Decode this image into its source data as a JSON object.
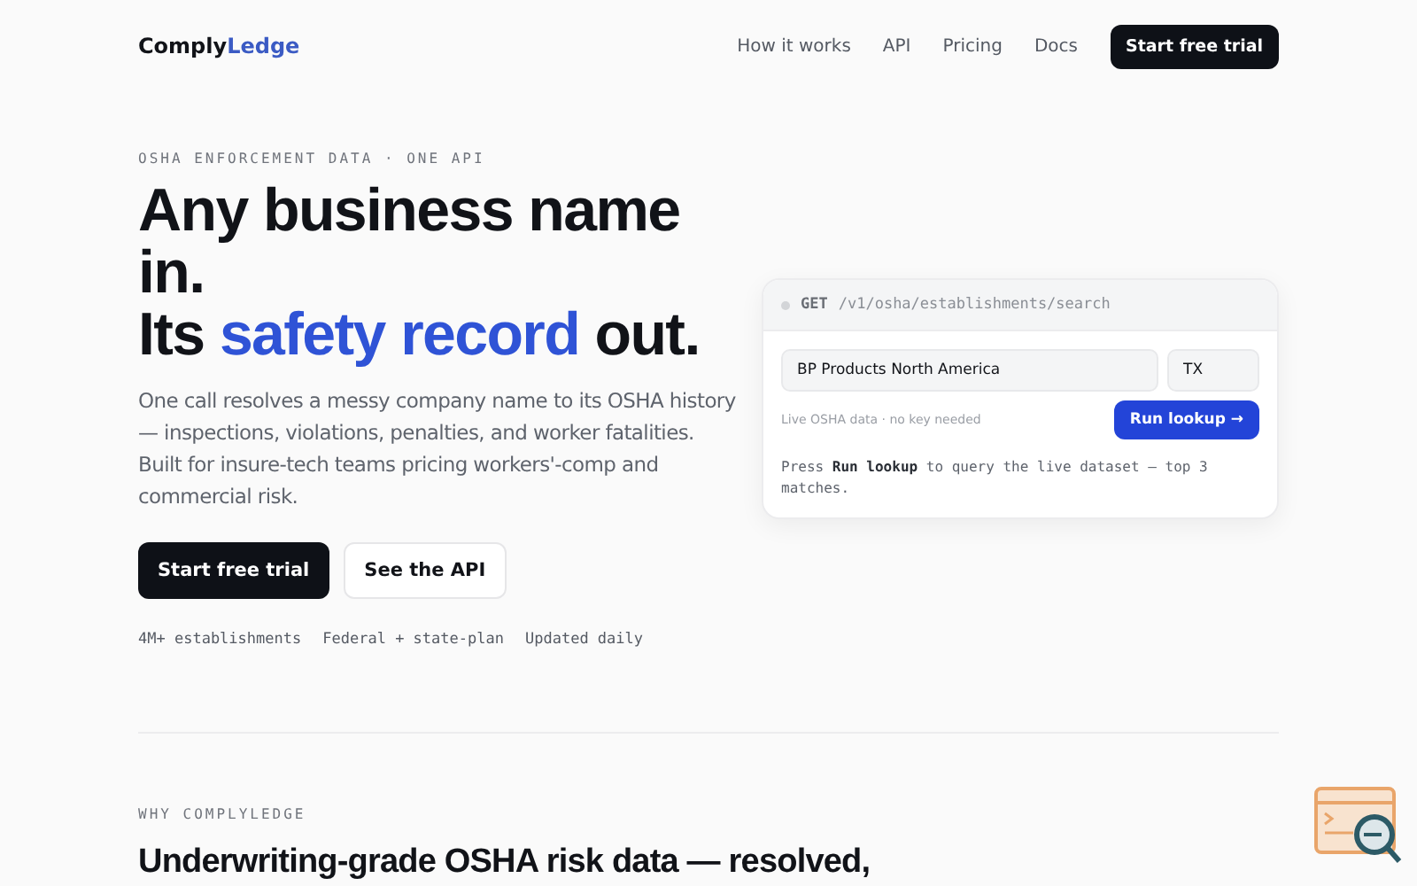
{
  "brand": {
    "name": "Comply",
    "accent": "Ledge"
  },
  "nav": {
    "links": [
      "How it works",
      "API",
      "Pricing",
      "Docs"
    ],
    "cta": "Start free trial"
  },
  "hero": {
    "eyebrow": "OSHA ENFORCEMENT DATA · ONE API",
    "headline": {
      "line_1": "Any business name in.",
      "line_2_start": "Its ",
      "line_2_highlight": "safety record",
      "line_2_end": " out."
    },
    "lede": "One call resolves a messy company name to its OSHA history — inspections, violations, penalties, and worker fatalities. Built for insure-tech teams pricing workers'-comp and commercial risk.",
    "buttons": [
      {
        "label": "Start free trial",
        "kind": "primary"
      },
      {
        "label": "See the API",
        "kind": "secondary"
      }
    ],
    "facts": [
      "4M+ establishments",
      "Federal + state-plan",
      "Updated daily"
    ]
  },
  "api_card": {
    "method": "GET",
    "path": "/v1/osha/establishments/search",
    "company_value": "BP Products North America",
    "state_value": "TX",
    "note": "Live OSHA data · no key needed",
    "button": "Run lookup →",
    "output": "Press **Run lookup** to query the live dataset — top 3 matches."
  },
  "why": {
    "eyebrow": "WHY COMPLYLEDGE",
    "heading": "Underwriting-grade OSHA risk data — resolved,"
  }
}
